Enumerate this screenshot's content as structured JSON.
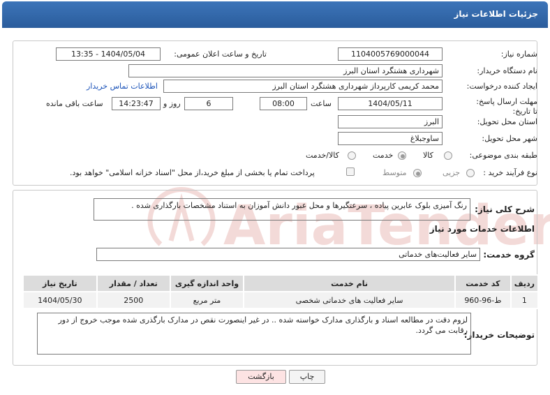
{
  "header": {
    "title": "جزئیات اطلاعات نیاز"
  },
  "form": {
    "need_number_label": "شماره نیاز:",
    "need_number": "1104005769000044",
    "announce_label": "تاریخ و ساعت اعلان عمومی:",
    "announce_value": "1404/05/04 - 13:35",
    "buyer_org_label": "نام دستگاه خریدار:",
    "buyer_org": "شهرداری هشتگرد استان البرز",
    "creator_label": "ایجاد کننده درخواست:",
    "creator": "محمد کریمی کارپرداز شهرداری هشتگرد استان البرز",
    "contact_link": "اطلاعات تماس خریدار",
    "deadline_label": "مهلت ارسال پاسخ: تا تاریخ:",
    "deadline_date": "1404/05/11",
    "time_label": "ساعت",
    "deadline_time": "08:00",
    "days_value": "6",
    "days_label": "روز و",
    "remaining_time": "14:23:47",
    "remaining_label": "ساعت باقی مانده",
    "province_label": "استان محل تحویل:",
    "province": "البرز",
    "city_label": "شهر محل تحویل:",
    "city": "ساوجبلاغ",
    "category_label": "طبقه بندی موضوعی:",
    "category_options": [
      "کالا",
      "خدمت",
      "کالا/خدمت"
    ],
    "category_selected": "خدمت",
    "process_label": "نوع فرآیند خرید :",
    "process_options": [
      "جزیی",
      "متوسط"
    ],
    "process_selected": "متوسط",
    "payment_note": "پرداخت تمام یا بخشی از مبلغ خرید،از محل \"اسناد خزانه اسلامی\" خواهد بود."
  },
  "details": {
    "summary_label": "شرح کلی نیاز:",
    "summary": "رنگ آمیزی بلوک عابرین پیاده ، سرعتگیرها و محل عبور دانش آموزان به استناد مشخصات بارگذاری شده .",
    "services_heading": "اطلاعات خدمات مورد نیاز",
    "service_group_label": "گروه خدمت:",
    "service_group": "سایر فعالیت‌های خدماتی",
    "table": {
      "headers": [
        "ردیف",
        "کد خدمت",
        "نام خدمت",
        "واحد اندازه گیری",
        "تعداد / مقدار",
        "تاریخ نیاز"
      ],
      "rows": [
        [
          "1",
          "ط-96-960",
          "سایر فعالیت های خدماتی شخصی",
          "متر مربع",
          "2500",
          "1404/05/30"
        ]
      ]
    },
    "buyer_notes_label": "توضیحات خریدار:",
    "buyer_notes": "لزوم دقت در مطالعه اسناد و بارگذاری مدارک خواسته شده .. در غیر اینصورت نقص در مدارک بارگذری شده موجب خروج از دور رقابت می گردد."
  },
  "buttons": {
    "print": "چاپ",
    "back": "بازگشت"
  },
  "watermark": {
    "text": "AriaTender.net"
  },
  "colors": {
    "header_bg": "#2f63a6",
    "link": "#1a52b8",
    "back_button_bg": "#fde3e3",
    "watermark": "#c0392b"
  }
}
